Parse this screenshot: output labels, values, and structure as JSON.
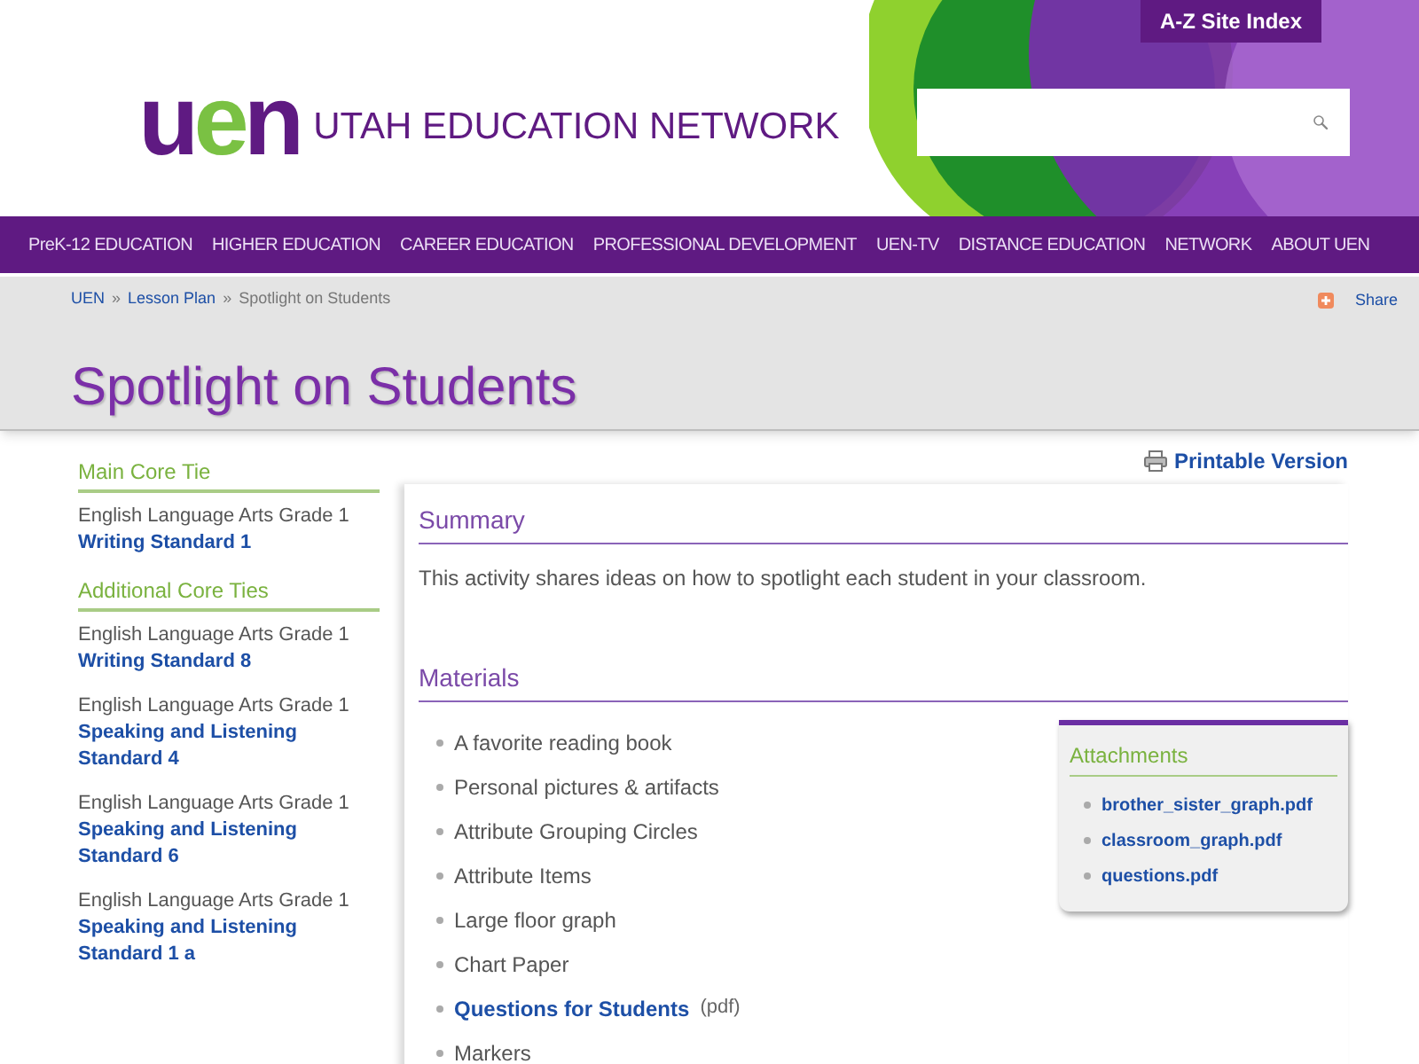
{
  "header": {
    "logo": "uen",
    "site_name": "UTAH EDUCATION NETWORK",
    "index_button": "A-Z Site Index"
  },
  "nav": [
    "PreK-12 EDUCATION",
    "HIGHER EDUCATION",
    "CAREER EDUCATION",
    "PROFESSIONAL DEVELOPMENT",
    "UEN-TV",
    "DISTANCE EDUCATION",
    "NETWORK",
    "ABOUT UEN"
  ],
  "breadcrumb": [
    {
      "label": "UEN",
      "kind": "link"
    },
    {
      "label": "»",
      "kind": "sep"
    },
    {
      "label": "Lesson Plan",
      "kind": "link"
    },
    {
      "label": "»",
      "kind": "sep"
    },
    {
      "label": "Spotlight on Students",
      "kind": "current"
    }
  ],
  "share": "Share",
  "title": "Spotlight on Students",
  "sidebar": [
    {
      "heading": "Main Core Tie",
      "ties": [
        {
          "subject": "English Language Arts Grade 1",
          "standard": "Writing Standard 1"
        }
      ]
    },
    {
      "heading": "Additional Core Ties",
      "ties": [
        {
          "subject": "English Language Arts Grade 1",
          "standard": "Writing Standard 8"
        },
        {
          "subject": "English Language Arts Grade 1",
          "standard": "Speaking and Listening Standard 4"
        },
        {
          "subject": "English Language Arts Grade 1",
          "standard": "Speaking and Listening Standard 6"
        },
        {
          "subject": "English Language Arts Grade 1",
          "standard": "Speaking and Listening Standard 1 a"
        }
      ]
    }
  ],
  "printable": "Printable Version",
  "summary": {
    "heading": "Summary",
    "text": "This activity shares ideas on how to spotlight each student in your classroom."
  },
  "materials": {
    "heading": "Materials",
    "items": [
      {
        "kind": "text",
        "label": "A favorite reading book"
      },
      {
        "kind": "text",
        "label": "Personal pictures & artifacts"
      },
      {
        "kind": "text",
        "label": "Attribute Grouping Circles"
      },
      {
        "kind": "text",
        "label": "Attribute Items"
      },
      {
        "kind": "text",
        "label": "Large floor graph"
      },
      {
        "kind": "text",
        "label": "Chart Paper"
      },
      {
        "kind": "link",
        "label": "Questions for Students",
        "note": "(pdf)"
      },
      {
        "kind": "text",
        "label": "Markers"
      }
    ]
  },
  "attachments": {
    "heading": "Attachments",
    "files": [
      "brother_sister_graph.pdf",
      "classroom_graph.pdf",
      "questions.pdf"
    ]
  }
}
